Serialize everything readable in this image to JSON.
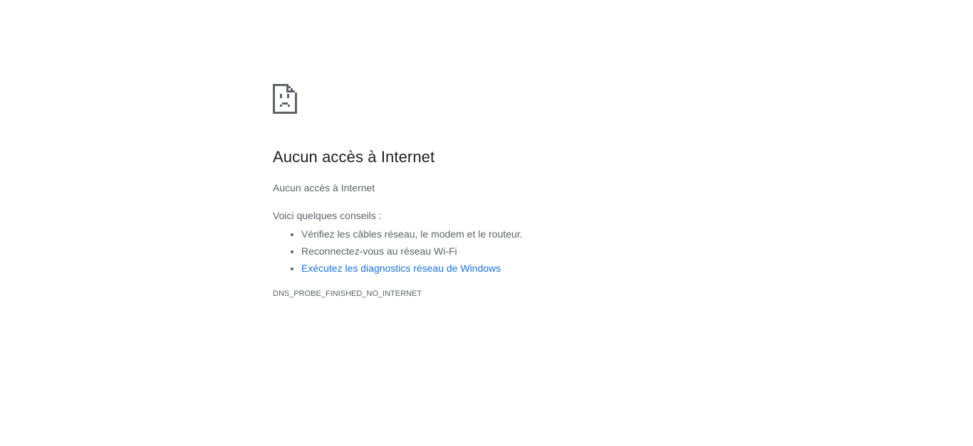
{
  "page": {
    "icon": "sad-page-icon",
    "title": "Aucun accès à Internet",
    "subtitle": "Aucun accès à Internet",
    "tips_heading": "Voici quelques conseils :",
    "tips": [
      {
        "text": "Vérifiez les câbles réseau, le modem et le routeur."
      },
      {
        "text": "Reconnectez-vous au réseau Wi-Fi"
      },
      {
        "text": "Exécutez les diagnostics réseau de Windows"
      }
    ],
    "error_code": "DNS_PROBE_FINISHED_NO_INTERNET"
  },
  "colors": {
    "title": "#202124",
    "body_text": "#5f6368",
    "link": "#1a73e8",
    "icon": "#5f6368"
  }
}
